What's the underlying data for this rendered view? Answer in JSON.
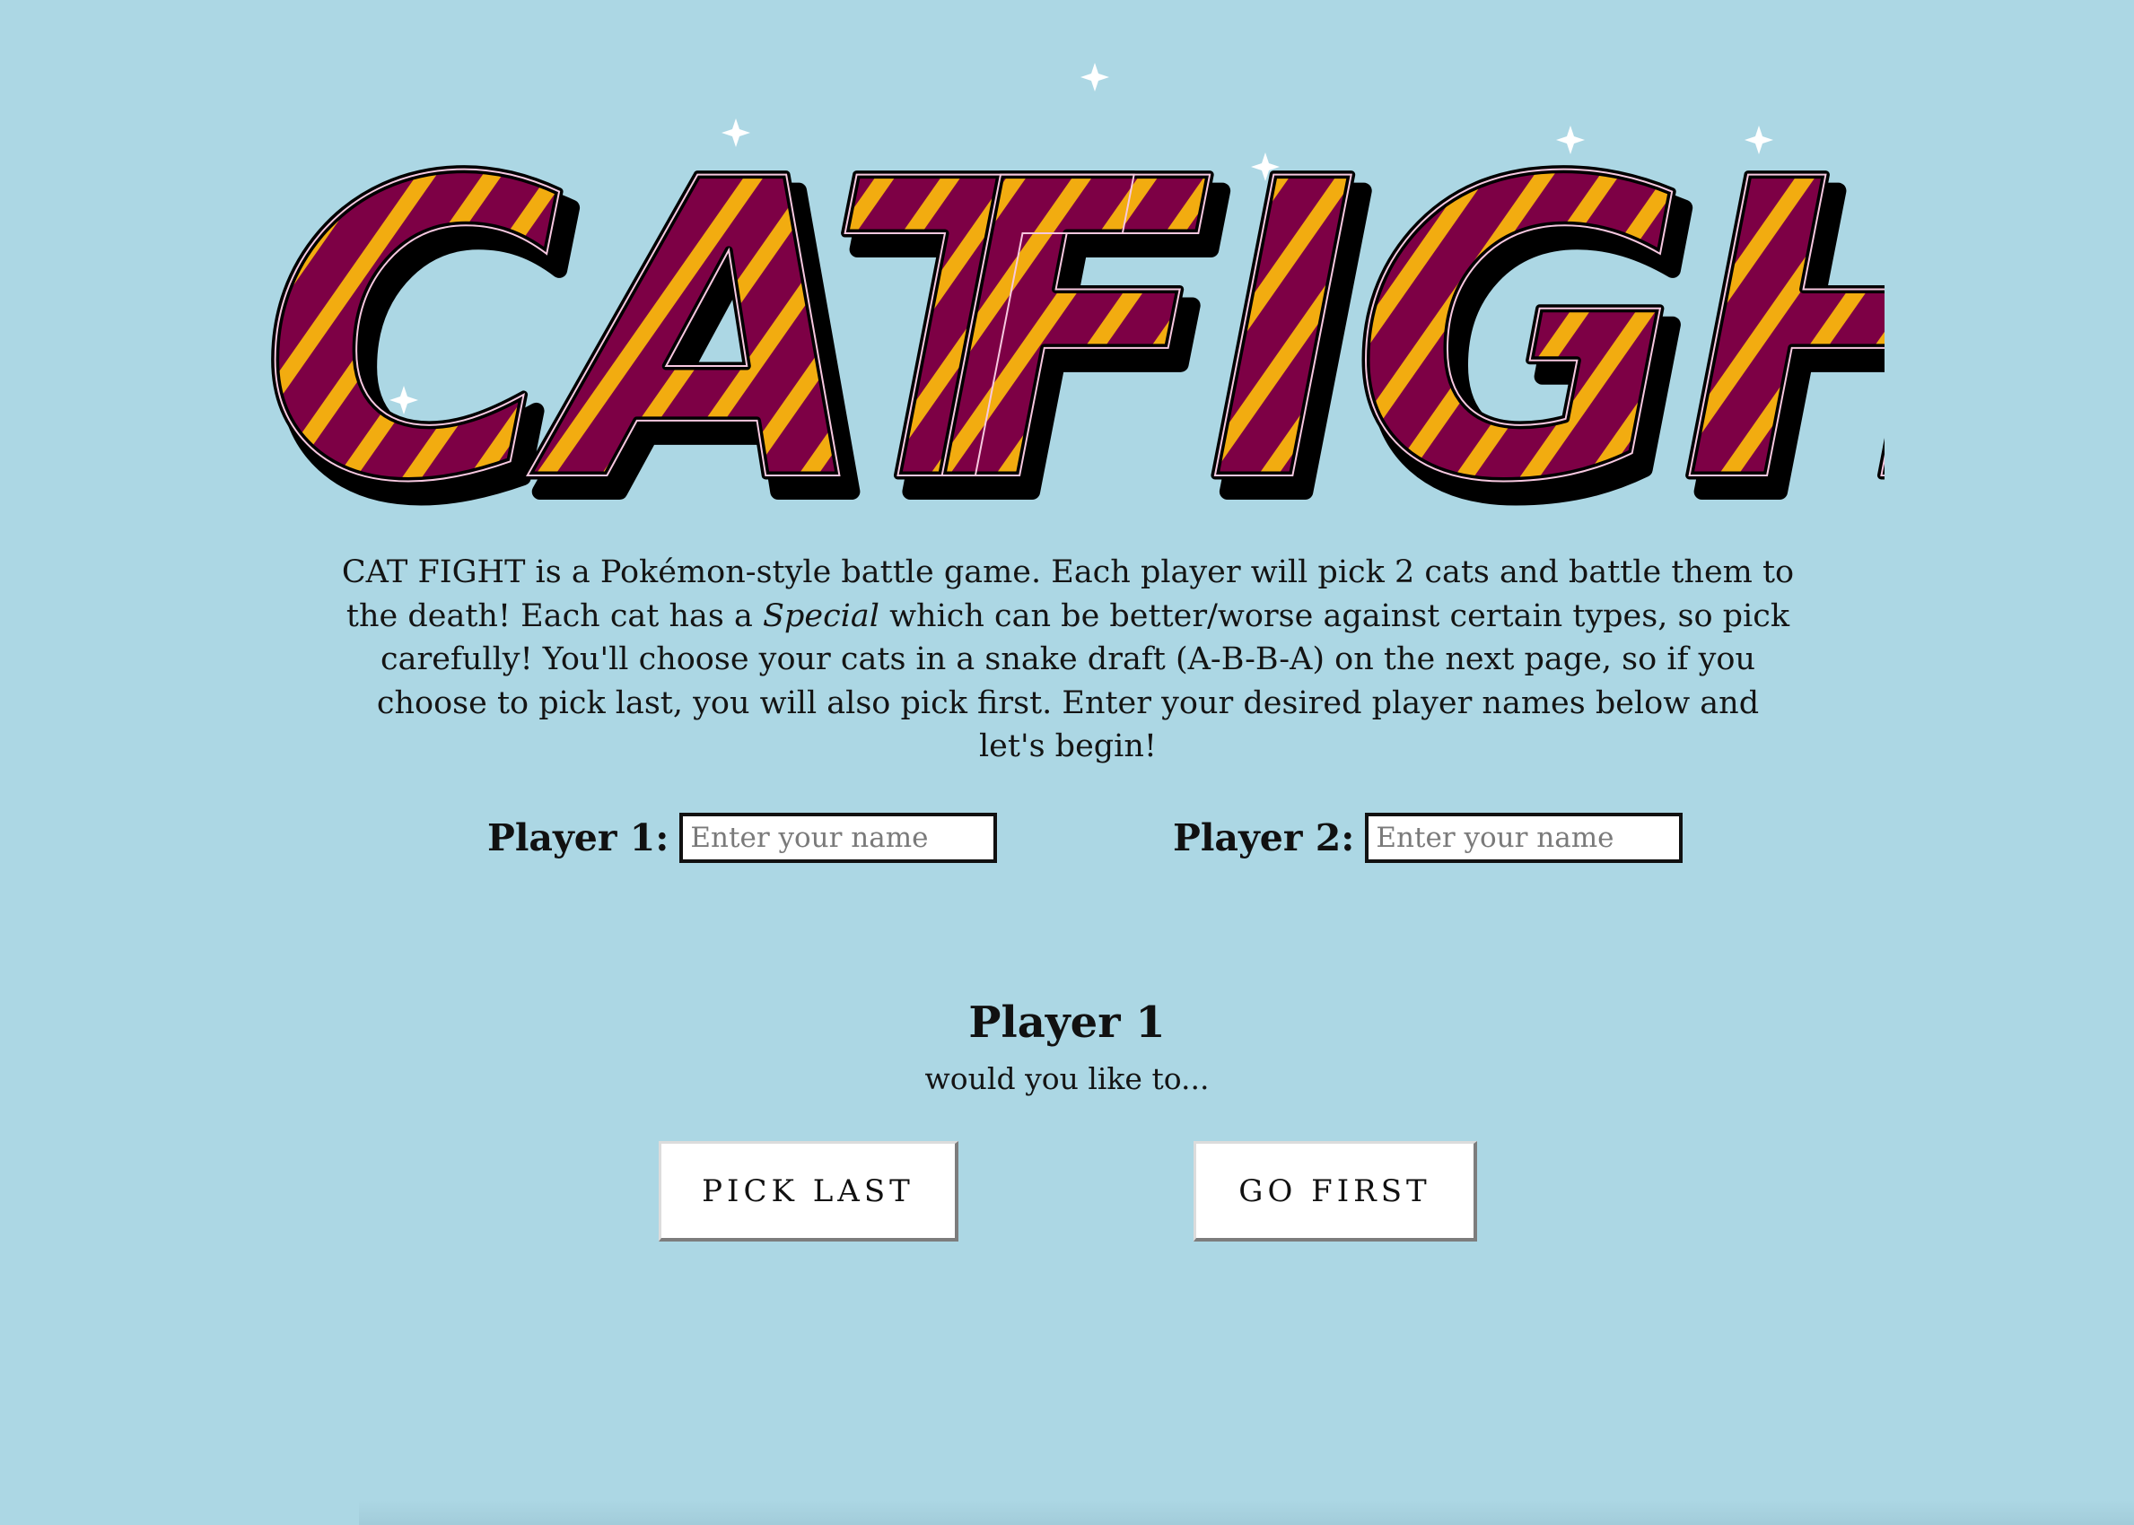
{
  "logo": {
    "word1": "CAT",
    "word2": "FIGHT",
    "colors": {
      "fill": "#7d0045",
      "accent": "#f2ac10",
      "outline": "#000000"
    }
  },
  "intro": {
    "text_before": "CAT FIGHT is a Pokémon-style battle game.  Each player will pick 2 cats and battle them to the death!  Each cat has a ",
    "special": "Special",
    "text_after": " which can be better/worse against certain types, so pick carefully! You'll choose your cats in a snake draft (A-B-B-A) on the next page, so if you choose to pick last, you will also pick first. Enter your desired player names below and let's begin!"
  },
  "players": [
    {
      "label": "Player 1:",
      "placeholder": "Enter your name",
      "value": ""
    },
    {
      "label": "Player 2:",
      "placeholder": "Enter your name",
      "value": ""
    }
  ],
  "prompt": {
    "player": "Player 1",
    "question": "would you like to..."
  },
  "buttons": {
    "pick_last": "PICK LAST",
    "go_first": "GO FIRST"
  },
  "colors": {
    "background": "#acd7e4",
    "button_bg": "#ffffff",
    "text": "#111111"
  }
}
